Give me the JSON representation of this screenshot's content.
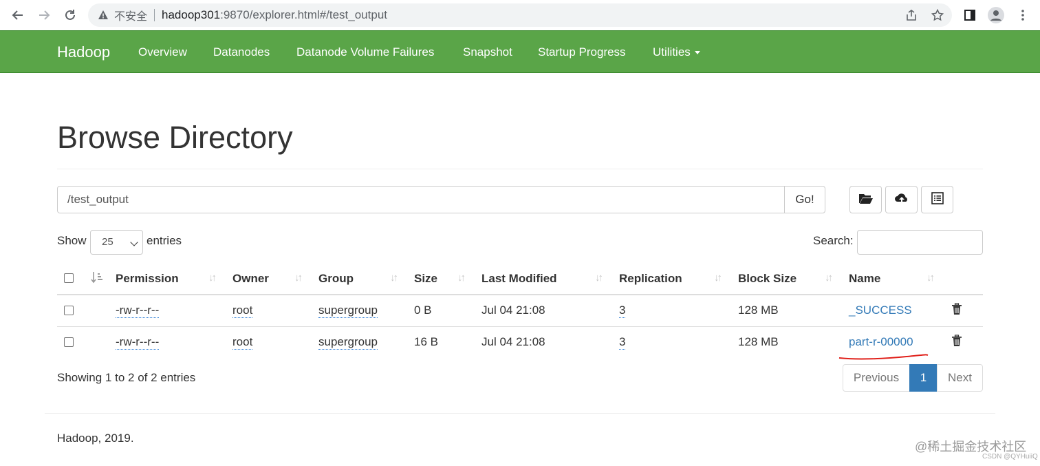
{
  "browser": {
    "insecure_label": "不安全",
    "url_host": "hadoop301",
    "url_rest": ":9870/explorer.html#/test_output"
  },
  "navbar": {
    "brand": "Hadoop",
    "items": [
      "Overview",
      "Datanodes",
      "Datanode Volume Failures",
      "Snapshot",
      "Startup Progress",
      "Utilities"
    ]
  },
  "page": {
    "title": "Browse Directory",
    "path_value": "/test_output",
    "go_label": "Go!"
  },
  "controls": {
    "show_label": "Show",
    "entries_per_page": "25",
    "entries_label": "entries",
    "search_label": "Search:"
  },
  "table": {
    "columns": [
      "Permission",
      "Owner",
      "Group",
      "Size",
      "Last Modified",
      "Replication",
      "Block Size",
      "Name"
    ],
    "rows": [
      {
        "permission": "-rw-r--r--",
        "owner": "root",
        "group": "supergroup",
        "size": "0 B",
        "last_modified": "Jul 04 21:08",
        "replication": "3",
        "block_size": "128 MB",
        "name": "_SUCCESS"
      },
      {
        "permission": "-rw-r--r--",
        "owner": "root",
        "group": "supergroup",
        "size": "16 B",
        "last_modified": "Jul 04 21:08",
        "replication": "3",
        "block_size": "128 MB",
        "name": "part-r-00000"
      }
    ]
  },
  "pagination": {
    "info": "Showing 1 to 2 of 2 entries",
    "previous": "Previous",
    "current": "1",
    "next": "Next"
  },
  "footer": {
    "text": "Hadoop, 2019."
  },
  "watermark": {
    "line1": "@稀土掘金技术社区",
    "line2": "CSDN @QYHuiiQ"
  },
  "colors": {
    "navbar_bg": "#5aa548",
    "link": "#337ab7",
    "active_page": "#337ab7",
    "annotation": "#e0201a"
  }
}
